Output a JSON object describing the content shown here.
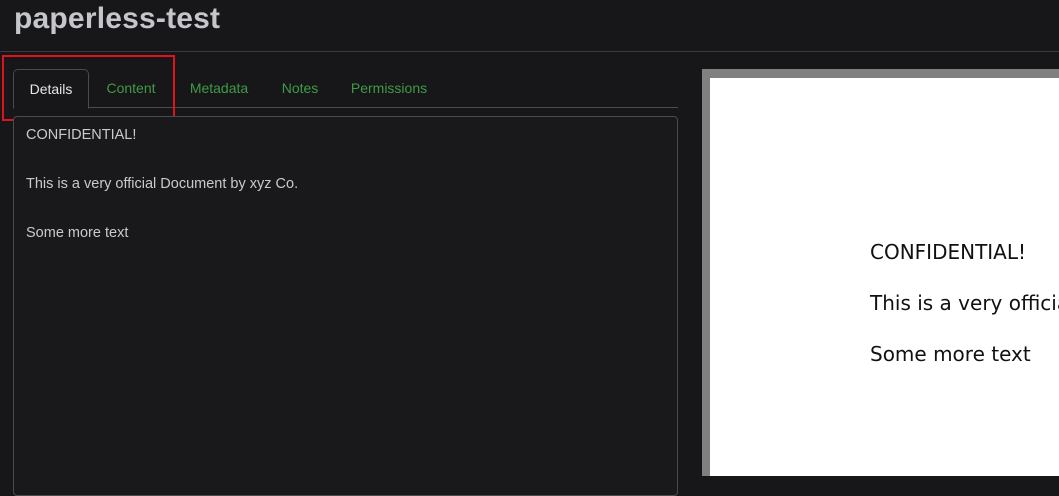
{
  "header": {
    "title": "paperless-test"
  },
  "tabs": [
    {
      "label": "Details",
      "active": true
    },
    {
      "label": "Content",
      "active": false
    },
    {
      "label": "Metadata",
      "active": false
    },
    {
      "label": "Notes",
      "active": false
    },
    {
      "label": "Permissions",
      "active": false
    }
  ],
  "content": {
    "lines": [
      "CONFIDENTIAL!",
      "This is a very official Document by xyz Co.",
      "Some more text"
    ]
  },
  "preview": {
    "lines": [
      "CONFIDENTIAL!",
      "This is a very official Document by xyz Co.",
      "Some more text"
    ]
  },
  "colors": {
    "accent_tab": "#3f9a46",
    "highlight": "#e0121b",
    "background": "#17171a"
  }
}
